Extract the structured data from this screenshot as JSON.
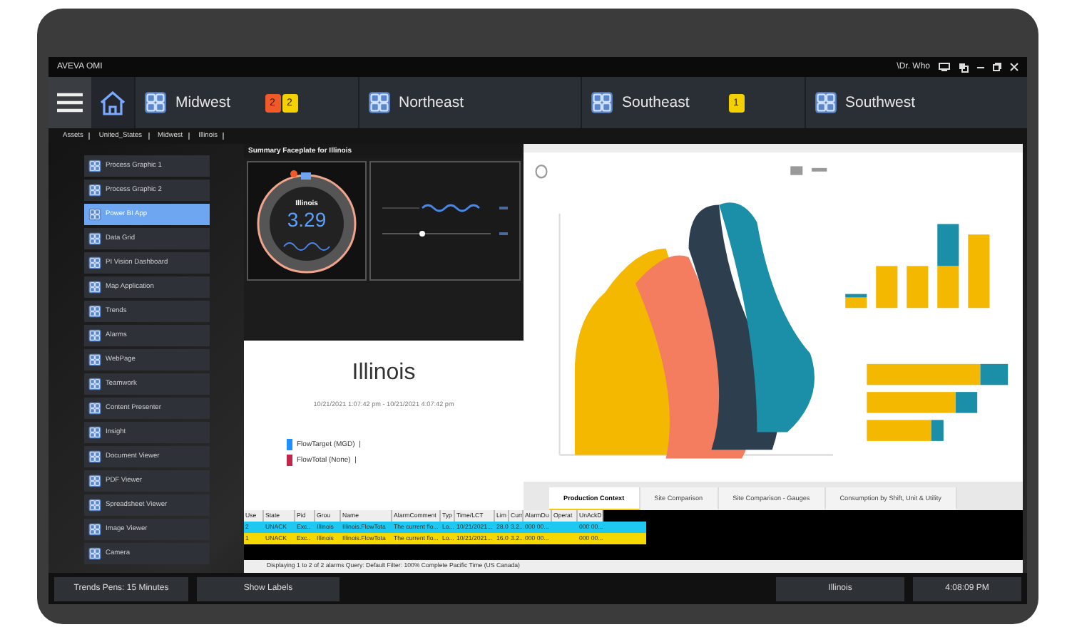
{
  "window": {
    "title": "AVEVA OMI",
    "user": "\\Dr. Who"
  },
  "nav": {
    "items": [
      {
        "label": "Midwest",
        "selected": false,
        "badges": [
          {
            "text": "2",
            "color": "#f05a28"
          },
          {
            "text": "2",
            "color": "#f5d000"
          }
        ]
      },
      {
        "label": "Northeast",
        "selected": false
      },
      {
        "label": "Southeast",
        "selected": false,
        "badges": [
          {
            "text": "1",
            "color": "#f5d000"
          }
        ]
      },
      {
        "label": "Southwest",
        "selected": false
      }
    ]
  },
  "breadcrumb": [
    "Assets",
    "United_States",
    "Midwest",
    "Illinois"
  ],
  "sidebar": {
    "items": [
      {
        "label": "Process Graphic 1",
        "selected": false
      },
      {
        "label": "Process Graphic 2",
        "selected": false
      },
      {
        "label": "Power BI App",
        "selected": true
      },
      {
        "label": "Data Grid",
        "selected": false
      },
      {
        "label": "PI Vision Dashboard",
        "selected": false
      },
      {
        "label": "Map Application",
        "selected": false
      },
      {
        "label": "Trends",
        "selected": false
      },
      {
        "label": "Alarms",
        "selected": false
      },
      {
        "label": "WebPage",
        "selected": false
      },
      {
        "label": "Teamwork",
        "selected": false
      },
      {
        "label": "Content Presenter",
        "selected": false
      },
      {
        "label": "Insight",
        "selected": false
      },
      {
        "label": "Document Viewer",
        "selected": false
      },
      {
        "label": "PDF Viewer",
        "selected": false
      },
      {
        "label": "Spreadsheet Viewer",
        "selected": false
      },
      {
        "label": "Image Viewer",
        "selected": false
      },
      {
        "label": "Camera",
        "selected": false
      }
    ]
  },
  "faceplate": {
    "title": "Summary Faceplate for Illinois",
    "gauge": {
      "label": "Illinois",
      "value": "3.29"
    }
  },
  "summary": {
    "title": "Illinois",
    "range": "10/21/2021 1:07:42 pm - 10/21/2021 4:07:42 pm",
    "legend": [
      {
        "label": "FlowTarget (MGD)  |",
        "color": "#1e90ff"
      },
      {
        "label": "FlowTotal (None)  |",
        "color": "#c0284a"
      }
    ]
  },
  "report": {
    "tabs": [
      {
        "label": "Production Context",
        "selected": true
      },
      {
        "label": "Site Comparison",
        "selected": false
      },
      {
        "label": "Site Comparison - Gauges",
        "selected": false
      },
      {
        "label": "Consumption by Shift, Unit & Utility",
        "selected": false
      }
    ]
  },
  "alarms": {
    "columns": [
      "Use",
      "State",
      "Pid",
      "Grou",
      "Name",
      "AlarmComment",
      "Typ",
      "Time/LCT",
      "Lim",
      "Curr",
      "AlarmDu",
      "Operat",
      "UnAckD"
    ],
    "rows": [
      {
        "color": "#1ec8f0",
        "cells": [
          "2",
          "UNACK",
          "Exc..",
          "Illinois",
          "Illinois.FlowTota",
          "The current flo...",
          "Lo...",
          "10/21/2021...",
          "28.0",
          "3.2...",
          "000 00...",
          "",
          "000 00..."
        ]
      },
      {
        "color": "#f5d800",
        "cells": [
          "1",
          "UNACK",
          "Exc..",
          "Illinois",
          "Illinois.FlowTota",
          "The current flo...",
          "Lo...",
          "10/21/2021...",
          "16.0",
          "3.2...",
          "000 00...",
          "",
          "000 00..."
        ]
      }
    ],
    "status": "Displaying 1 to 2 of 2 alarms   Query: Default   Filter:   100% Complete   Pacific Time (US Canada)"
  },
  "bottom_bar": {
    "buttons": [
      "Trends Pens: 15 Minutes",
      "Show Labels"
    ],
    "location": "Illinois",
    "time": "4:08:09 PM"
  }
}
